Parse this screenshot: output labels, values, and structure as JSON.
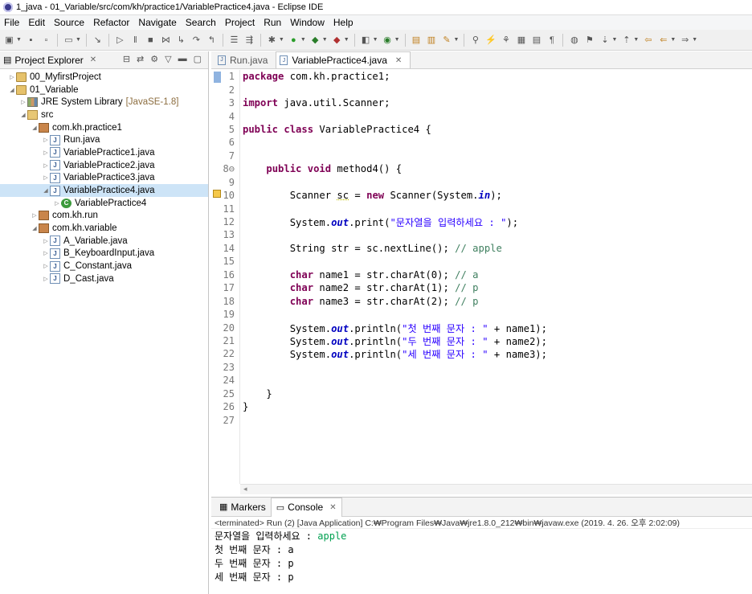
{
  "window": {
    "title": "1_java - 01_Variable/src/com/kh/practice1/VariablePractice4.java - Eclipse IDE"
  },
  "menu": [
    "File",
    "Edit",
    "Source",
    "Refactor",
    "Navigate",
    "Search",
    "Project",
    "Run",
    "Window",
    "Help"
  ],
  "explorer": {
    "tab_label": "Project Explorer",
    "tree": [
      {
        "label": "00_MyfirstProject",
        "suffix": ""
      },
      {
        "label": "01_Variable",
        "suffix": ""
      },
      {
        "label": "JRE System Library",
        "suffix": "[JavaSE-1.8]"
      },
      {
        "label": "src",
        "suffix": ""
      },
      {
        "label": "com.kh.practice1",
        "suffix": ""
      },
      {
        "label": "Run.java",
        "suffix": ""
      },
      {
        "label": "VariablePractice1.java",
        "suffix": ""
      },
      {
        "label": "VariablePractice2.java",
        "suffix": ""
      },
      {
        "label": "VariablePractice3.java",
        "suffix": ""
      },
      {
        "label": "VariablePractice4.java",
        "suffix": ""
      },
      {
        "label": "VariablePractice4",
        "suffix": ""
      },
      {
        "label": "com.kh.run",
        "suffix": ""
      },
      {
        "label": "com.kh.variable",
        "suffix": ""
      },
      {
        "label": "A_Variable.java",
        "suffix": ""
      },
      {
        "label": "B_KeyboardInput.java",
        "suffix": ""
      },
      {
        "label": "C_Constant.java",
        "suffix": ""
      },
      {
        "label": "D_Cast.java",
        "suffix": ""
      }
    ]
  },
  "editor": {
    "tabs": [
      {
        "label": "Run.java"
      },
      {
        "label": "VariablePractice4.java"
      }
    ],
    "line_numbers": [
      "1",
      "2",
      "3",
      "4",
      "5",
      "6",
      "7",
      "8⊖",
      "9",
      "10",
      "11",
      "12",
      "13",
      "14",
      "15",
      "16",
      "17",
      "18",
      "19",
      "20",
      "21",
      "22",
      "23",
      "24",
      "25",
      "26",
      "27"
    ],
    "tokens": {
      "l1_kw": "package",
      "l1_rest": " com.kh.practice1;",
      "l3_kw": "import",
      "l3_rest": " java.util.Scanner;",
      "l5_kw1": "public",
      "l5_kw2": "class",
      "l5_rest": " VariablePractice4 {",
      "l8_kw1": "public",
      "l8_kw2": "void",
      "l8_rest": " method4() {",
      "l10_a": "Scanner ",
      "l10_var": "sc",
      "l10_b": " = ",
      "l10_kw": "new",
      "l10_c": " Scanner(System.",
      "l10_st": "in",
      "l10_d": ");",
      "l12_a": "System.",
      "l12_st": "out",
      "l12_b": ".print(",
      "l12_str": "\"문자열을 입력하세요 : \"",
      "l12_c": ");",
      "l14_a": "String str = sc.nextLine(); ",
      "l14_cm": "// apple",
      "l16_kw": "char",
      "l16_a": " name1 = str.charAt(0); ",
      "l16_cm": "// a",
      "l17_kw": "char",
      "l17_a": " name2 = str.charAt(1); ",
      "l17_cm": "// p",
      "l18_kw": "char",
      "l18_a": " name3 = str.charAt(2); ",
      "l18_cm": "// p",
      "l20_a": "System.",
      "l20_st": "out",
      "l20_b": ".println(",
      "l20_str": "\"첫 번째 문자 : \"",
      "l20_c": " + name1);",
      "l21_a": "System.",
      "l21_st": "out",
      "l21_b": ".println(",
      "l21_str": "\"두 번째 문자 : \"",
      "l21_c": " + name2);",
      "l22_a": "System.",
      "l22_st": "out",
      "l22_b": ".println(",
      "l22_str": "\"세 번째 문자 : \"",
      "l22_c": " + name3);",
      "l25": "}",
      "l26": "}"
    }
  },
  "console": {
    "tabs": [
      {
        "label": "Markers"
      },
      {
        "label": "Console"
      }
    ],
    "status": "<terminated> Run (2) [Java Application] C:₩Program Files₩Java₩jre1.8.0_212₩bin₩javaw.exe (2019. 4. 26. 오후 2:02:09)",
    "prompt": "문자열을 입력하세요 : ",
    "input": "apple",
    "output": [
      "첫 번째 문자 : a",
      "두 번째 문자 : p",
      "세 번째 문자 : p"
    ]
  },
  "colors": {
    "keyword": "#7f0055",
    "string": "#2a00ff",
    "comment": "#3f7f5f",
    "static_field": "#0000c0",
    "console_input": "#00a050"
  }
}
